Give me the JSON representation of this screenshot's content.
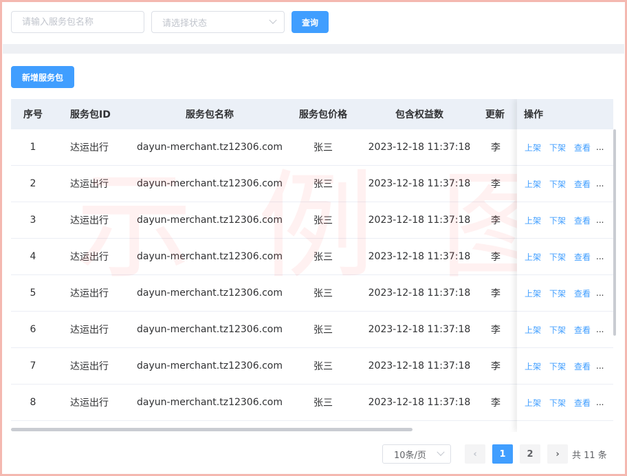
{
  "filters": {
    "name_placeholder": "请输入服务包名称",
    "status_placeholder": "请选择状态",
    "query_label": "查询"
  },
  "toolbar": {
    "add_label": "新增服务包"
  },
  "table": {
    "headers": {
      "index": "序号",
      "package_id": "服务包ID",
      "package_name": "服务包名称",
      "price": "服务包价格",
      "rights_count": "包含权益数",
      "updated_by": "更新",
      "actions": "操作"
    },
    "rows": [
      {
        "index": "1",
        "package_id": "达运出行",
        "package_name": "dayun-merchant.tz12306.com",
        "price": "张三",
        "rights_count": "2023-12-18 11:37:18",
        "updated_by": "李"
      },
      {
        "index": "2",
        "package_id": "达运出行",
        "package_name": "dayun-merchant.tz12306.com",
        "price": "张三",
        "rights_count": "2023-12-18 11:37:18",
        "updated_by": "李"
      },
      {
        "index": "3",
        "package_id": "达运出行",
        "package_name": "dayun-merchant.tz12306.com",
        "price": "张三",
        "rights_count": "2023-12-18 11:37:18",
        "updated_by": "李"
      },
      {
        "index": "4",
        "package_id": "达运出行",
        "package_name": "dayun-merchant.tz12306.com",
        "price": "张三",
        "rights_count": "2023-12-18 11:37:18",
        "updated_by": "李"
      },
      {
        "index": "5",
        "package_id": "达运出行",
        "package_name": "dayun-merchant.tz12306.com",
        "price": "张三",
        "rights_count": "2023-12-18 11:37:18",
        "updated_by": "李"
      },
      {
        "index": "6",
        "package_id": "达运出行",
        "package_name": "dayun-merchant.tz12306.com",
        "price": "张三",
        "rights_count": "2023-12-18 11:37:18",
        "updated_by": "李"
      },
      {
        "index": "7",
        "package_id": "达运出行",
        "package_name": "dayun-merchant.tz12306.com",
        "price": "张三",
        "rights_count": "2023-12-18 11:37:18",
        "updated_by": "李"
      },
      {
        "index": "8",
        "package_id": "达运出行",
        "package_name": "dayun-merchant.tz12306.com",
        "price": "张三",
        "rights_count": "2023-12-18 11:37:18",
        "updated_by": "李"
      }
    ],
    "actions": {
      "shelve": "上架",
      "unshelve": "下架",
      "view": "查看",
      "more": "..."
    }
  },
  "watermark": [
    "示",
    "例",
    "图"
  ],
  "pagination": {
    "page_size": "10条/页",
    "pages": [
      "1",
      "2"
    ],
    "current_page": "1",
    "total_text": "共 11 条"
  },
  "colors": {
    "primary": "#409eff",
    "header_bg": "#ebf0f7",
    "frame": "#f4b8b0"
  }
}
